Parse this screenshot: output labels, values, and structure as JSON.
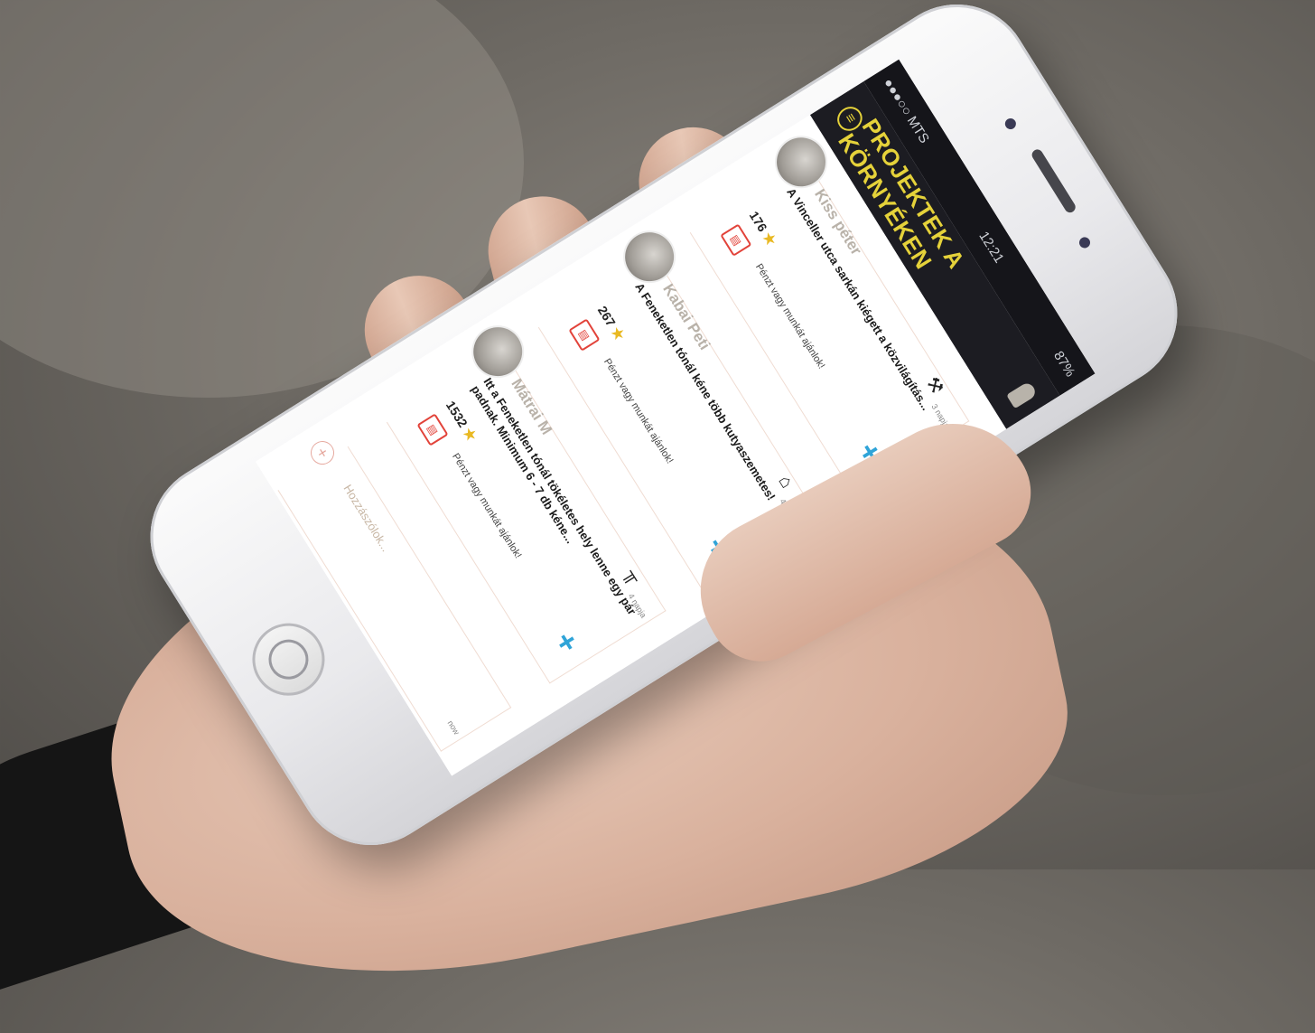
{
  "status_bar": {
    "carrier": "●●●○○ MTS",
    "time": "12:21",
    "battery": "87%"
  },
  "header": {
    "title": "PROJEKTEK A KÖRNYÉKEN"
  },
  "posts": [
    {
      "author": "Kiss péter",
      "title": "A Vinceller utca sarkán kiégett a közvilágítás...",
      "votes": "176",
      "offer_text": "Pénzt vagy munkát ajánlok!",
      "time": "3 napja",
      "type_icon": "hammer-icon"
    },
    {
      "author": "Kabai Peti",
      "title": "A Feneketlen tónál kéne több kutyaszemetes!",
      "votes": "267",
      "offer_text": "Pénzt vagy munkát ajánlok!",
      "time": "4 napja",
      "type_icon": "trash-bin-icon"
    },
    {
      "author": "Mátrai M",
      "title": "Itt a Feneketlen tónál tökéletes hely lenne egy pár padnak. Minimum 6 - 7 db kéne...",
      "votes": "1532",
      "offer_text": "Pénzt vagy munkát ajánlok!",
      "time": "4 napja",
      "type_icon": "bench-icon"
    }
  ],
  "comment_box": {
    "placeholder": "Hozzászólok...",
    "time": "now"
  },
  "colors": {
    "accent_yellow": "#e5d23a",
    "add_blue": "#2fa4d8",
    "star_gold": "#e9b923",
    "book_red": "#e2433a"
  }
}
